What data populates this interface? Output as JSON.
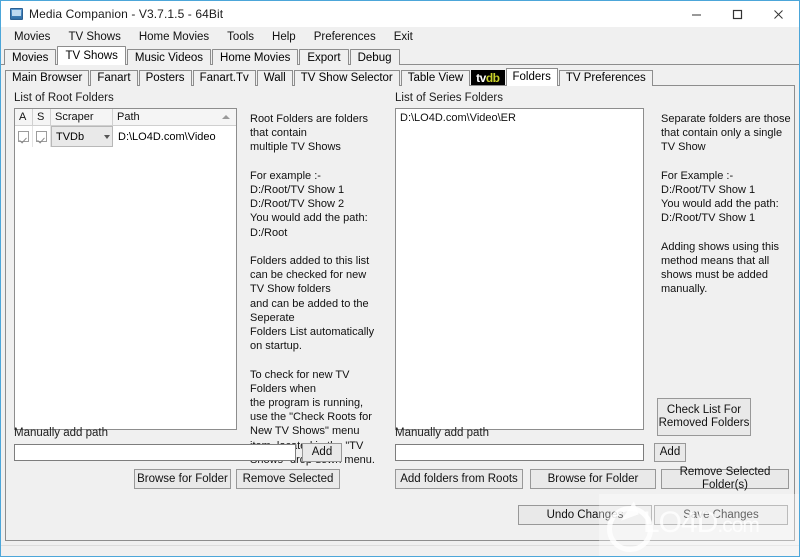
{
  "window": {
    "title": "Media Companion - V3.7.1.5 - 64Bit",
    "icon": "app-monitor-icon",
    "minimize": "–",
    "maximize": "❑",
    "close": "✕",
    "border_color": "#4ca6d9"
  },
  "menu": {
    "items": [
      {
        "label": "Movies"
      },
      {
        "label": "TV Shows"
      },
      {
        "label": "Home Movies"
      },
      {
        "label": "Tools"
      },
      {
        "label": "Help"
      },
      {
        "label": "Preferences"
      },
      {
        "label": "Exit"
      }
    ]
  },
  "mode_tabs": {
    "selected": "TV Shows",
    "items": [
      {
        "label": "Movies",
        "selected": false
      },
      {
        "label": "TV Shows",
        "selected": true
      },
      {
        "label": "Music Videos",
        "selected": false
      },
      {
        "label": "Home Movies",
        "selected": false
      },
      {
        "label": "Export",
        "selected": false
      },
      {
        "label": "Debug",
        "selected": false
      }
    ]
  },
  "content_tabs": {
    "selected": "Folders",
    "items": [
      {
        "label": "Main Browser",
        "selected": false,
        "type": "text"
      },
      {
        "label": "Fanart",
        "selected": false,
        "type": "text"
      },
      {
        "label": "Posters",
        "selected": false,
        "type": "text"
      },
      {
        "label": "Fanart.Tv",
        "selected": false,
        "type": "text"
      },
      {
        "label": "Wall",
        "selected": false,
        "type": "text"
      },
      {
        "label": "TV Show Selector",
        "selected": false,
        "type": "text"
      },
      {
        "label": "Table View",
        "selected": false,
        "type": "text"
      },
      {
        "label": "tvdb",
        "selected": false,
        "type": "logo"
      },
      {
        "label": "Folders",
        "selected": true,
        "type": "text"
      },
      {
        "label": "TV Preferences",
        "selected": false,
        "type": "text"
      }
    ],
    "logo": {
      "part1": "tv",
      "part2": "db",
      "bg": "#000000",
      "fg1": "#ffffff",
      "fg2": "#c8d02a"
    }
  },
  "root_panel": {
    "group_label": "List of Root Folders",
    "grid": {
      "columns": [
        "A",
        "S",
        "Scraper",
        "Path"
      ],
      "sorted_column": "Path",
      "sort_direction": "ascending",
      "rows": [
        {
          "a_checked": true,
          "s_checked": true,
          "scraper": "TVDb",
          "path": "D:\\LO4D.com\\Video"
        }
      ]
    },
    "help_text": "Root Folders are folders that contain\nmultiple TV Shows\n\nFor example :-\nD:/Root/TV Show 1\nD:/Root/TV Show 2\nYou would add the path:\nD:/Root\n\nFolders added to this list can be checked for new TV Show folders\nand can be added to the Seperate\nFolders List automatically on startup.\n\nTo check for new TV Folders when\nthe program is running, use the \"Check Roots for New TV Shows\" menu item, located in the \"TV Shows\" drop down menu.",
    "manual_add_label": "Manually add path",
    "manual_add_value": "",
    "manual_add_placeholder": "",
    "add_button": "Add",
    "browse_button": "Browse for Folder",
    "remove_button": "Remove Selected"
  },
  "series_panel": {
    "group_label": "List of Series Folders",
    "list_items": [
      "D:\\LO4D.com\\Video\\ER"
    ],
    "help_text": "Separate folders are those that contain only a single TV Show\n\nFor Example :-\nD:/Root/TV Show 1\nYou would add the path:\nD:/Root/TV Show 1\n\nAdding shows using this method means that all shows must be added manually.",
    "check_list_button": "Check List For\nRemoved Folders",
    "check_list_line1": "Check List For",
    "check_list_line2": "Removed Folders",
    "manual_add_label": "Manually add path",
    "manual_add_value": "",
    "add_button": "Add",
    "add_from_roots_button": "Add folders from Roots",
    "browse_button": "Browse for Folder",
    "remove_button": "Remove Selected Folder(s)"
  },
  "footer": {
    "undo_button": "Undo Changes",
    "save_button": "Save Changes"
  },
  "watermark": {
    "text": "LO4D",
    "suffix": ".com"
  }
}
